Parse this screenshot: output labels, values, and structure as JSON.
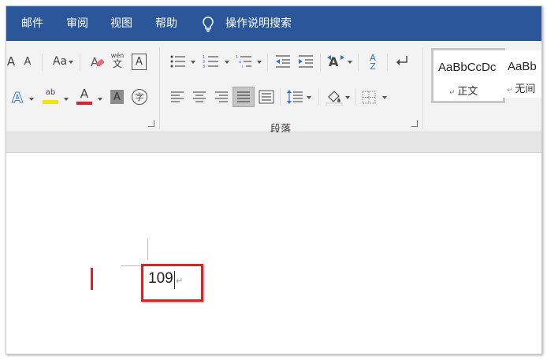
{
  "menu": {
    "items": [
      "邮件",
      "审阅",
      "视图",
      "帮助"
    ],
    "search_label": "操作说明搜索"
  },
  "ribbon": {
    "font_group": {
      "grow_font": "A",
      "shrink_font": "A",
      "change_case": "Aa",
      "phonetic_top": "wén",
      "phonetic_bottom": "文",
      "char_border": "A",
      "text_effects": "A",
      "highlight": "ab",
      "font_color": "A",
      "char_shading": "A",
      "enclose_char": "字",
      "colors": {
        "highlight": "#f5e400",
        "font_color": "#e21c2a"
      }
    },
    "paragraph_group": {
      "label": "段落",
      "sort": "A",
      "sort_sub": "Z"
    },
    "styles_group": {
      "items": [
        {
          "preview": "AaBbCcDc",
          "name": "正文"
        },
        {
          "preview": "AaBb",
          "name": "无间"
        }
      ]
    }
  },
  "document": {
    "text": "109",
    "paragraph_mark": "↵"
  },
  "colors": {
    "menubar": "#2b579a",
    "accent_red": "#e21c2a"
  }
}
